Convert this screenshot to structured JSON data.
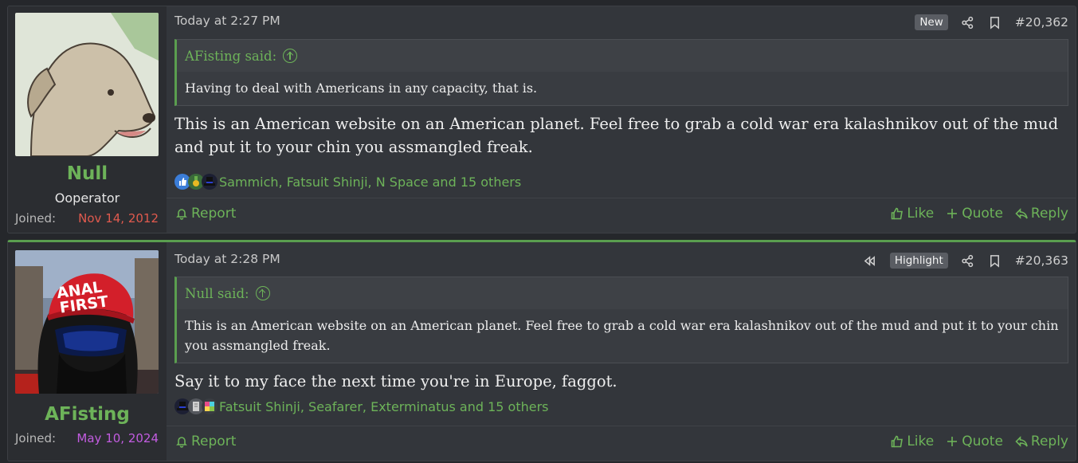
{
  "posts": [
    {
      "username": "Null",
      "user_title": "Ooperator",
      "joined_label": "Joined:",
      "joined_date": "Nov 14, 2012",
      "joined_color": "#e05a4e",
      "time": "Today at 2:27 PM",
      "tag": "New",
      "post_number": "#20,362",
      "quote": {
        "author": "AFisting said:",
        "text": "Having to deal with Americans in any capacity, that is."
      },
      "message": "This is an American website on an American planet. Feel free to grab a cold war era kalashnikov out of the mud and put it to your chin you assmangled freak.",
      "reactions_text": "Sammich, Fatsuit Shinji, N Space and 15 others",
      "report_label": "Report",
      "like_label": "Like",
      "quote_label": "Quote",
      "reply_label": "Reply"
    },
    {
      "username": "AFisting",
      "user_title": "",
      "joined_label": "Joined:",
      "joined_date": "May 10, 2024",
      "joined_color": "#c25ce0",
      "time": "Today at 2:28 PM",
      "tag": "Highlight",
      "post_number": "#20,363",
      "quote": {
        "author": "Null said:",
        "text": "This is an American website on an American planet. Feel free to grab a cold war era kalashnikov out of the mud and put it to your chin you assmangled freak."
      },
      "message": "Say it to my face the next time you're in Europe, faggot.",
      "reactions_text": "Fatsuit Shinji, Seafarer, Exterminatus and 15 others",
      "report_label": "Report",
      "like_label": "Like",
      "quote_label": "Quote",
      "reply_label": "Reply"
    }
  ],
  "avatar_1_text": "",
  "avatar_2_cap_text": "ANAL FIRST",
  "colors": {
    "accent": "#6db359",
    "background": "#25272b",
    "post_bg": "#33363b"
  },
  "icons": [
    "share-icon",
    "bookmark-icon",
    "rewind-icon",
    "bell-icon",
    "thumbs-up-icon",
    "plus-icon",
    "reply-icon",
    "quote-arrow-icon"
  ]
}
